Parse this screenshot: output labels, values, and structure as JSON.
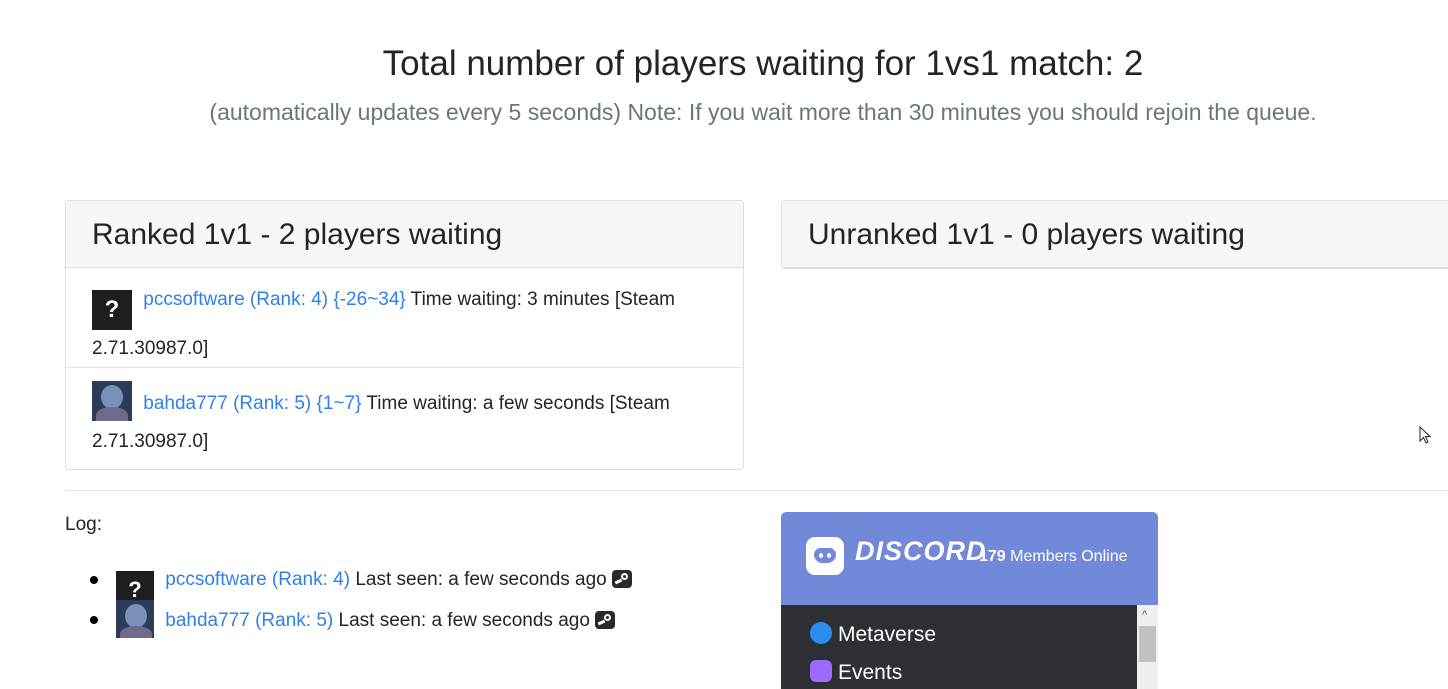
{
  "header": {
    "title": "Total number of players waiting for 1vs1 match: 2",
    "subtitle": "(automatically updates every 5 seconds) Note: If you wait more than 30 minutes you should rejoin the queue."
  },
  "ranked": {
    "title": "Ranked 1v1 - 2 players waiting",
    "players": [
      {
        "avatar": "?",
        "name": "pccsoftware (Rank: 4) {-26~34}",
        "info_line1": " Time waiting: 3 minutes [Steam",
        "info_line2": "2.71.30987.0]"
      },
      {
        "avatar": "",
        "name": "bahda777 (Rank: 5) {1~7}",
        "info_line1": " Time waiting: a few seconds [Steam",
        "info_line2": "2.71.30987.0]"
      }
    ]
  },
  "unranked": {
    "title": "Unranked 1v1 - 0 players waiting"
  },
  "log": {
    "label": "Log:",
    "entries": [
      {
        "avatar": "?",
        "name": "pccsoftware (Rank: 4)",
        "status": " Last seen: a few seconds ago"
      },
      {
        "avatar": "",
        "name": "bahda777 (Rank: 5)",
        "status": " Last seen: a few seconds ago"
      }
    ]
  },
  "discord": {
    "brand": "DISCORD",
    "members_count": "179",
    "members_label": " Members Online",
    "channels": [
      "Metaverse",
      "Events"
    ]
  },
  "colors": {
    "link": "#2f81e8",
    "discord_blurple": "#7289da",
    "discord_dark": "#2c2f33"
  }
}
